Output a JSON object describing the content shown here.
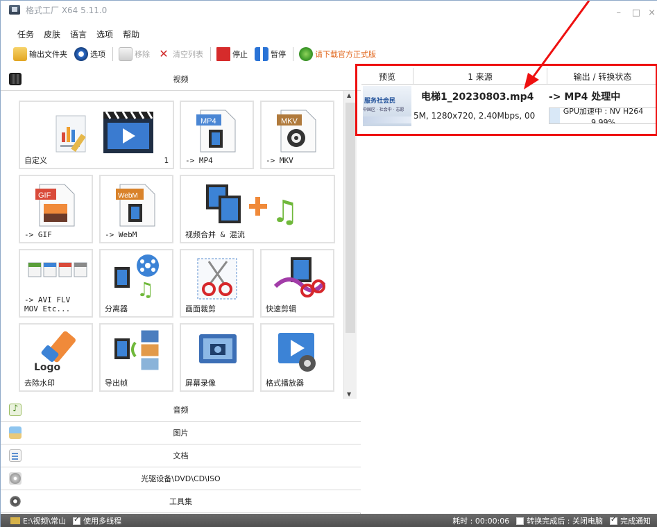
{
  "window": {
    "title": "格式工厂 X64 5.11.0",
    "controls": {
      "minimize": "–",
      "maximize": "□",
      "close": "×"
    }
  },
  "menu": [
    "任务",
    "皮肤",
    "语言",
    "选项",
    "帮助"
  ],
  "toolbar": {
    "output_folder": "输出文件夹",
    "options": "选项",
    "remove": "移除",
    "clear_list": "清空列表",
    "stop": "停止",
    "pause": "暂停",
    "download_official": "请下载官方正式版"
  },
  "categories": {
    "video": "视频",
    "audio": "音频",
    "image": "图片",
    "document": "文档",
    "disc": "光驱设备\\DVD\\CD\\ISO",
    "tools": "工具集"
  },
  "tiles": {
    "custom": {
      "label": "自定义",
      "count": "1"
    },
    "mp4": {
      "label": "-> MP4",
      "badge": "MP4"
    },
    "mkv": {
      "label": "-> MKV",
      "badge": "MKV"
    },
    "gif": {
      "label": "-> GIF",
      "badge": "GIF"
    },
    "webm": {
      "label": "-> WebM",
      "badge": "WebM"
    },
    "merge": {
      "label": "视频合并 & 混流"
    },
    "avi": {
      "label_line1": "-> AVI FLV",
      "label_line2": "MOV Etc..."
    },
    "separator": {
      "label": "分离器"
    },
    "crop": {
      "label": "画面裁剪"
    },
    "quick_cut": {
      "label": "快速剪辑"
    },
    "remove_watermark": {
      "label": "去除水印",
      "art_text": "Logo"
    },
    "export_frames": {
      "label": "导出帧"
    },
    "screen_record": {
      "label": "屏幕录像"
    },
    "player": {
      "label": "格式播放器"
    }
  },
  "task_table": {
    "headers": {
      "preview": "预览",
      "source": "1 来源",
      "status": "输出 / 转换状态"
    },
    "job": {
      "thumb_title": "服务社会民",
      "thumb_subtitle": "中国区 · 社会中 · 志愿",
      "filename": "电梯1_20230803.mp4",
      "target": "-> MP4 处理中",
      "meta": "5M, 1280x720, 2.40Mbps, 00",
      "status_line": "GPU加速中 : NV H264",
      "progress_text": "9.99%",
      "progress_value": 9.99
    }
  },
  "statusbar": {
    "path": "E:\\视频\\常山",
    "multithread": "使用多线程",
    "elapsed": "耗时 : 00:00:06",
    "after_done": "转换完成后 : 关闭电脑",
    "notify": "完成通知"
  },
  "colors": {
    "annotation": "#ee1010",
    "accent_blue": "#2a73d6",
    "stop_red": "#d62b2b",
    "download_orange": "#e2681e"
  }
}
